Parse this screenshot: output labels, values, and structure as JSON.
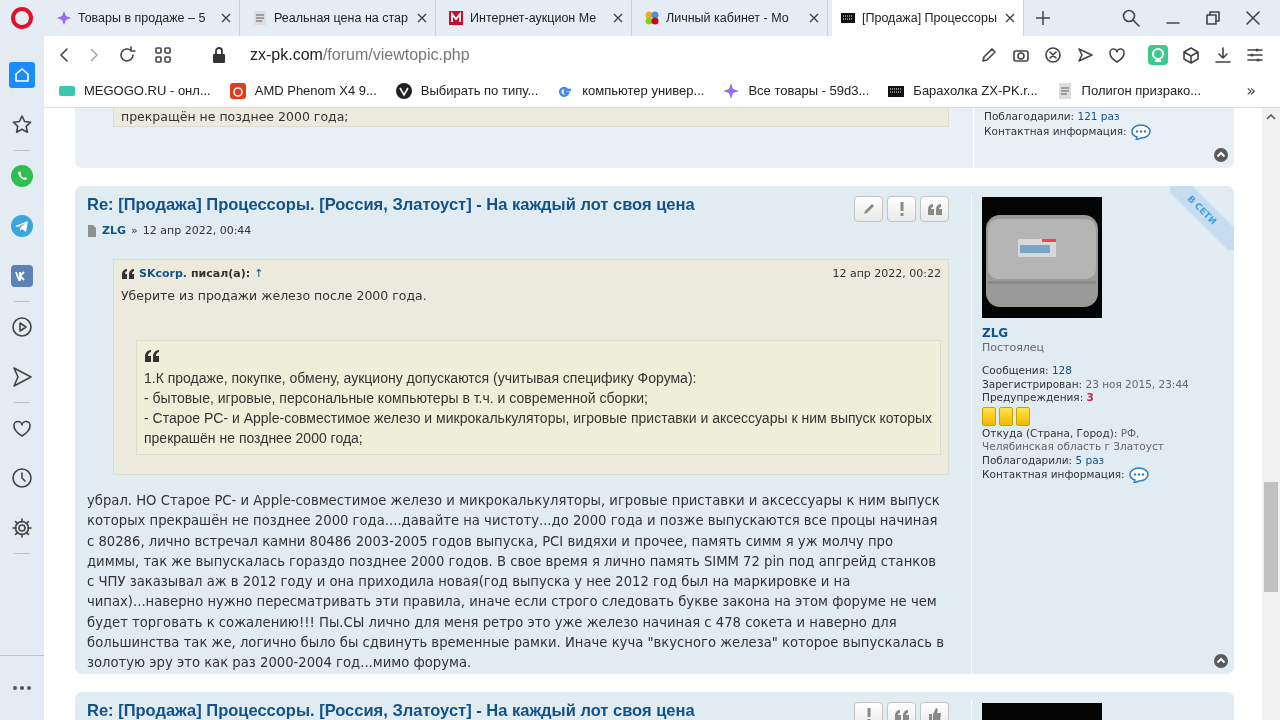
{
  "browser": {
    "tabs": [
      {
        "title": "Товары в продаже – 5",
        "selected": false
      },
      {
        "title": "Реальная цена на стар",
        "selected": false
      },
      {
        "title": "Интернет-аукцион Ме",
        "selected": false
      },
      {
        "title": "Личный кабинет - Мо",
        "selected": false
      },
      {
        "title": "[Продажа] Процессоры",
        "selected": true
      }
    ],
    "address": {
      "host": "zx-pk.com",
      "path": "/forum/viewtopic.php"
    },
    "bookmarks": [
      {
        "label": "MEGOGO.RU - онл..."
      },
      {
        "label": "AMD Phenom X4 9..."
      },
      {
        "label": "Выбирать по типу..."
      },
      {
        "label": "компьютер универ..."
      },
      {
        "label": "Все товары - 59d3..."
      },
      {
        "label": "Барахолка ZX-PK.r..."
      },
      {
        "label": "Полигон призрако..."
      }
    ],
    "bookmarks_more": "»"
  },
  "posts": [
    {
      "quote_tail": "прекращён не позднее 2000 года;",
      "profile": {
        "fields": [
          {
            "kind": "link",
            "label": "Поблагодарили:",
            "value": "121 раз"
          },
          {
            "kind": "contact",
            "label": "Контактная информация:"
          }
        ]
      }
    },
    {
      "title": "Re: [Продажа] Процессоры. [Россия, Златоуст] - На каждый лот своя цена",
      "author": "ZLG",
      "date_separator": "»",
      "date": "12 апр 2022, 00:44",
      "online_badge": "В СЕТИ",
      "buttons": [
        {
          "kind": "edit"
        },
        {
          "kind": "report"
        },
        {
          "kind": "quote"
        }
      ],
      "quote": {
        "author": "SKcorp.",
        "wrote": "писал(а):",
        "jump": "↑",
        "date": "12 апр 2022, 00:22",
        "text": "Уберите из продажи железо после 2000 года.",
        "nested": [
          "1.К продаже, покупке, обмену, аукциону допускаются (учитывая специфику Форума):",
          "- бытовые, игровые, персональные компьютеры в т.ч. и современной сборки;",
          "- Старое PC- и Apple-совместимое железо и микрокалькуляторы, игровые приставки и аксессуары к ним выпуск которых прекрашён не позднее 2000 года;"
        ]
      },
      "body": "убрал. НО Старое PC- и Apple-совместимое железо и микрокалькуляторы, игровые приставки и аксессуары к ним выпуск которых прекрашён не позднее 2000 года....давайте на чистоту...до 2000 года и позже выпускаются все процы начиная с 80286, лично встречал камни 80486 2003-2005 годов выпуска, PCI видяхи и прочее, память симм я уж молчу про диммы, так же выпускалась гораздо позднее 2000 годов. В свое время я лично память SIMM 72 pin под апгрейд станков с ЧПУ заказывал аж в 2012 году и она приходила новая(год выпуска у нее 2012 год был на маркировке и на чипах)...наверно нужно пересматривать эти правила, иначе если строго следовать букве закона на этом форуме не чем будет торговать к сожалению!!! Пы.СЫ лично для меня ретро это уже железо начиная с 478 сокета и наверно для большинства так же, логично было бы сдвинуть временные рамки. Иначе куча \"вкусного железа\" которое выпускалась в золотую эру это как раз 2000-2004 год...мимо форума.",
      "profile": {
        "username": "ZLG",
        "rank": "Постоялец",
        "fields": [
          {
            "kind": "link",
            "label": "Сообщения:",
            "value": "128"
          },
          {
            "kind": "plain",
            "label": "Зарегистрирован:",
            "value": "23 ноя 2015, 23:44"
          },
          {
            "kind": "warning",
            "label": "Предупреждения:",
            "value": "3"
          },
          {
            "kind": "cards",
            "stars": 3
          },
          {
            "kind": "plain",
            "label": "Откуда (Страна, Город):",
            "value": "РФ, Челябинская область г Златоуст"
          },
          {
            "kind": "link",
            "label": "Поблагодарили:",
            "value": "5 раз"
          },
          {
            "kind": "contact",
            "label": "Контактная информация:"
          }
        ]
      }
    },
    {
      "title": "Re: [Продажа] Процессоры. [Россия, Златоуст] - На каждый лот своя цена",
      "buttons": [
        {
          "kind": "report"
        },
        {
          "kind": "quote"
        },
        {
          "kind": "like"
        }
      ]
    }
  ]
}
